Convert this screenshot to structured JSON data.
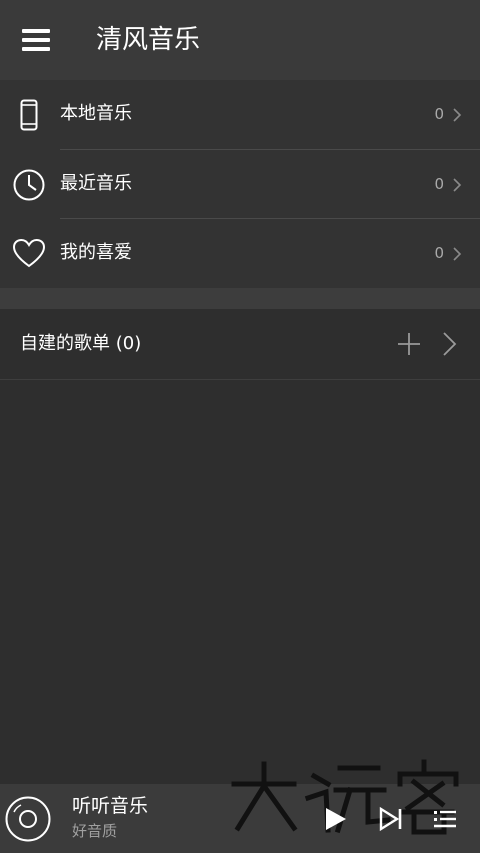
{
  "app": {
    "title": "清风音乐"
  },
  "menu": {
    "items": [
      {
        "label": "本地音乐",
        "count": "0",
        "icon": "phone-icon"
      },
      {
        "label": "最近音乐",
        "count": "0",
        "icon": "clock-icon"
      },
      {
        "label": "我的喜爱",
        "count": "0",
        "icon": "heart-icon"
      }
    ]
  },
  "playlists": {
    "label": "自建的歌单 (0)",
    "add_icon": "plus-icon",
    "chevron_icon": "chevron-right-icon"
  },
  "player": {
    "title": "听听音乐",
    "subtitle": "好音质",
    "icons": [
      "disc-icon",
      "play-icon",
      "skip-next-icon",
      "playlist-queue-icon"
    ]
  },
  "watermark": {
    "text": "大玩客"
  },
  "colors": {
    "background": "#2e2e2e",
    "topbar": "#3a3a3a",
    "menu_card": "#333333",
    "player_bar": "#3b3b3b",
    "text_primary": "#ffffff",
    "text_secondary": "#aaaaaa"
  }
}
